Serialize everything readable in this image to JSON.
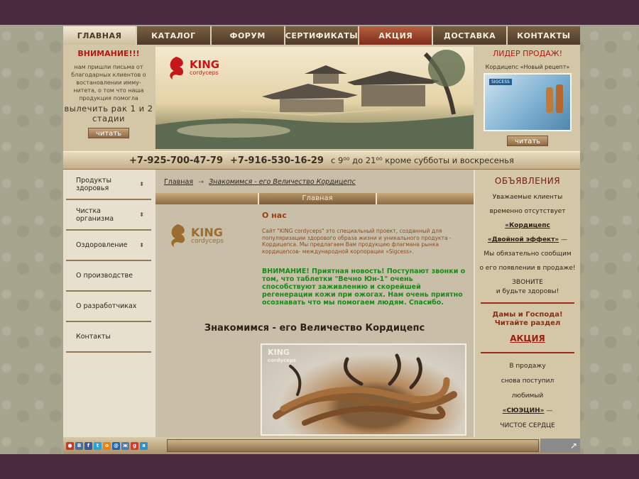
{
  "nav": [
    {
      "label": "ГЛАВНАЯ",
      "active": true
    },
    {
      "label": "КАТАЛОГ"
    },
    {
      "label": "ФОРУМ"
    },
    {
      "label": "СЕРТИФИКАТЫ"
    },
    {
      "label": "АКЦИЯ",
      "promo": true
    },
    {
      "label": "ДОСТАВКА"
    },
    {
      "label": "КОНТАКТЫ"
    }
  ],
  "alert": {
    "title": "ВНИМАНИЕ!!!",
    "text": "нам пришли письма от благодарных клиентов о востановлении имму-нитета, о том что наша продукция помогла",
    "big": "вылечить рак 1 и 2 стадии",
    "button": "читать"
  },
  "banner": {
    "logo_main": "KING",
    "logo_sub": "cordyceps"
  },
  "bestseller": {
    "title": "ЛИДЕР ПРОДАЖ!",
    "subtitle": "Кордицепс «Новый рецепт»",
    "product_label": "SIGCESS",
    "button": "читать"
  },
  "phones": {
    "phone1": "+7-925-700-47-79",
    "phone2": "+7-916-530-16-29",
    "hours": "с 9⁰⁰ до 21⁰⁰ кроме субботы и воскресенья"
  },
  "sidebar": [
    {
      "label": "Продукты здоровья",
      "arrow": true
    },
    {
      "label": "Чистка организма",
      "arrow": true
    },
    {
      "label": "Оздоровление",
      "arrow": true
    },
    {
      "label": "О производстве",
      "arrow": false
    },
    {
      "label": "О разработчиках",
      "arrow": false
    },
    {
      "label": "Контакты",
      "arrow": false
    }
  ],
  "breadcrumb": {
    "home": "Главная",
    "current": "Знакомимся - его Величество Кордицепс"
  },
  "section_bar": "Главная",
  "about": {
    "logo_main": "KING",
    "logo_sub": "cordyceps",
    "title": "О нас",
    "text": "Сайт \"KING cordyceps\" это специальный проект, созданный для популяризации здорового образа жизни и уникального продукта - Кордицепса. Мы предлагаем Вам продукцию флагмана рынка кордицепсов- международной корпорации «Sigcess».",
    "news": "ВНИМАНИЕ! Приятная новость! Поступают звонки о том, что таблетки \"Вечно Юн-1\" очень способствуют заживлению и скорейшей регенерации кожи при ожогах. Нам очень приятно осознавать что мы помогаем людям. Спасибо."
  },
  "main_heading": "Знакомимся - его Величество Кордицепс",
  "photo": {
    "logo_main": "KING",
    "logo_sub": "cordyceps"
  },
  "right": {
    "title": "ОБЪЯВЛЕНИЯ",
    "line1": "Уважаемые клиенты",
    "line2": "временно отсутствует",
    "prod1": "«Кордицепс",
    "prod2": "«Двойной эффект»",
    "prod2_tail": " —",
    "line3": "Мы обязательно сообщим",
    "line4": "о его появлении в продаже!",
    "call": "ЗВОНИТЕ",
    "health": "и будьте здоровы!",
    "red1": "Дамы и Господа!",
    "red2": "Читайте раздел",
    "promo": "АКЦИЯ",
    "sale1": "В продажу",
    "sale2": "снова поступил",
    "sale3": "любимый",
    "sale4": "«СЮЭЦИН»",
    "sale4_tail": " —",
    "sale5": "ЧИСТОЕ СЕРДЦЕ"
  },
  "share": [
    {
      "name": "share-icon-generic",
      "color": "#d0341e",
      "glyph": "●"
    },
    {
      "name": "vk-icon",
      "color": "#4a6e9c",
      "glyph": "В"
    },
    {
      "name": "facebook-icon",
      "color": "#3b5998",
      "glyph": "f"
    },
    {
      "name": "twitter-icon",
      "color": "#2aa3d8",
      "glyph": "t"
    },
    {
      "name": "odnoklassniki-icon",
      "color": "#ee8208",
      "glyph": "о"
    },
    {
      "name": "mailru-icon",
      "color": "#1e63b5",
      "glyph": "@"
    },
    {
      "name": "livejournal-icon",
      "color": "#4a7db0",
      "glyph": "ж"
    },
    {
      "name": "google-plus-icon",
      "color": "#d23a2a",
      "glyph": "g"
    },
    {
      "name": "yaru-icon",
      "color": "#2f8fd0",
      "glyph": "я"
    }
  ]
}
